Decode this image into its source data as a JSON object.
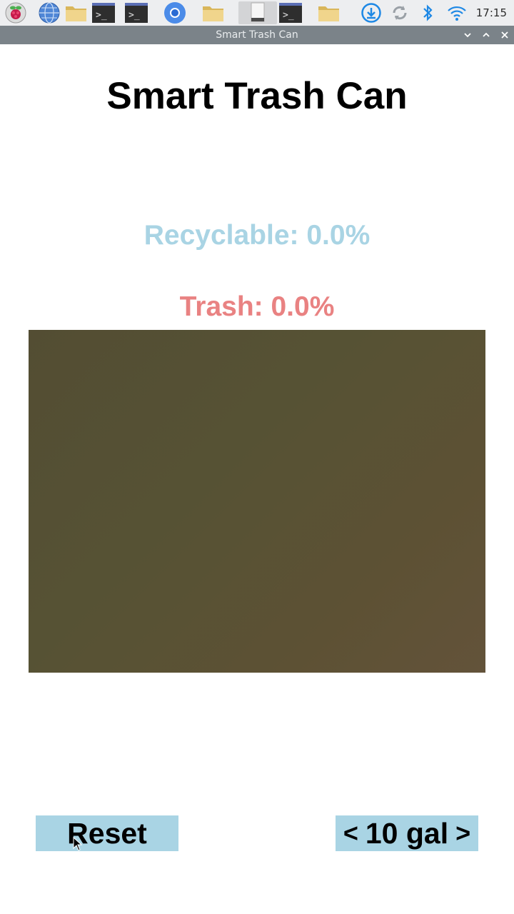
{
  "taskbar": {
    "clock": "17:15",
    "icons": [
      "raspberry-menu-icon",
      "web-browser-icon",
      "file-manager-icon",
      "terminal-icon",
      "terminal-icon",
      "chromium-icon",
      "file-manager-icon",
      "document-icon",
      "terminal-icon",
      "file-manager-icon",
      "download-icon",
      "sync-icon",
      "bluetooth-icon",
      "wifi-icon"
    ]
  },
  "window": {
    "title": "Smart Trash Can"
  },
  "app": {
    "title": "Smart Trash Can",
    "recyclable_text": "Recyclable: 0.0%",
    "trash_text": "Trash: 0.0%",
    "reset_label": "Reset",
    "size_prev": "<",
    "size_value": "10 gal",
    "size_next": ">"
  },
  "colors": {
    "recyclable": "#a9d4e4",
    "trash": "#e98282",
    "button_bg": "#a9d4e4",
    "titlebar": "#7b8389"
  }
}
